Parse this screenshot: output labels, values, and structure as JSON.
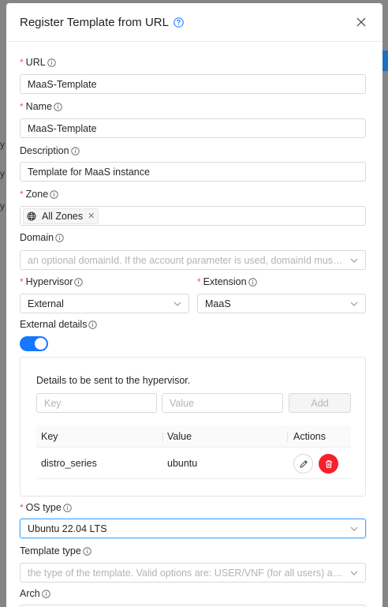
{
  "modal": {
    "title": "Register Template from URL",
    "close_icon": "close-icon",
    "help_icon": "question-circle-icon"
  },
  "colors": {
    "accent": "#1677ff",
    "required": "#ff4d4f",
    "danger": "#f5222d"
  },
  "form": {
    "url": {
      "label": "URL",
      "required": true,
      "value": "MaaS-Template"
    },
    "name": {
      "label": "Name",
      "required": true,
      "value": "MaaS-Template"
    },
    "description": {
      "label": "Description",
      "required": false,
      "value": "Template for MaaS instance"
    },
    "zone": {
      "label": "Zone",
      "required": true,
      "tag": "All Zones"
    },
    "domain": {
      "label": "Domain",
      "required": false,
      "placeholder": "an optional domainId. If the account parameter is used, domainId must also ..."
    },
    "hypervisor": {
      "label": "Hypervisor",
      "required": true,
      "value": "External"
    },
    "extension": {
      "label": "Extension",
      "required": true,
      "value": "MaaS"
    },
    "external_details": {
      "label": "External details",
      "enabled": true,
      "description": "Details to be sent to the hypervisor.",
      "key_placeholder": "Key",
      "value_placeholder": "Value",
      "add_label": "Add",
      "columns": [
        "Key",
        "Value",
        "Actions"
      ],
      "rows": [
        {
          "key": "distro_series",
          "value": "ubuntu"
        }
      ]
    },
    "os_type": {
      "label": "OS type",
      "required": true,
      "value": "Ubuntu 22.04 LTS"
    },
    "template_type": {
      "label": "Template type",
      "required": false,
      "placeholder": "the type of the template. Valid options are: USER/VNF (for all users) and SYS..."
    },
    "arch": {
      "label": "Arch",
      "required": false
    }
  }
}
